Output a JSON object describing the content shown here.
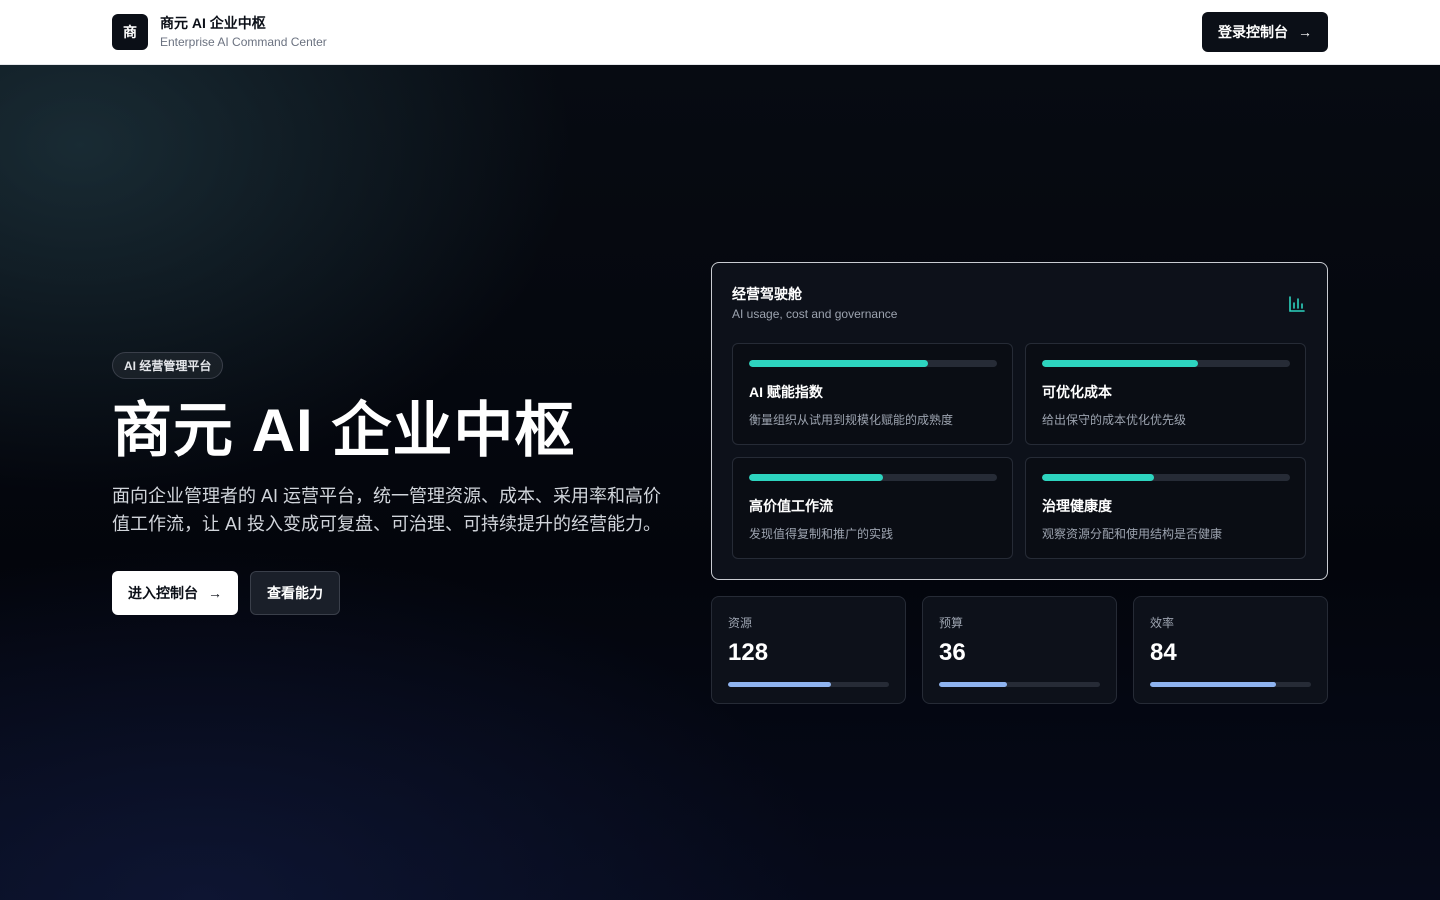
{
  "header": {
    "logo_char": "商",
    "brand_name": "商元 AI 企业中枢",
    "brand_sub": "Enterprise AI Command Center",
    "login_label": "登录控制台",
    "arrow": "→"
  },
  "hero": {
    "badge": "AI 经营管理平台",
    "title": "商元 AI 企业中枢",
    "description": "面向企业管理者的 AI 运营平台，统一管理资源、成本、采用率和高价值工作流，让 AI 投入变成可复盘、可治理、可持续提升的经营能力。",
    "primary_label": "进入控制台",
    "secondary_label": "查看能力",
    "arrow": "→"
  },
  "panel": {
    "title": "经营驾驶舱",
    "subtitle": "AI usage, cost and governance",
    "icon": "bar-chart-icon",
    "accent": "#2dd4bf",
    "features": [
      {
        "title": "AI 赋能指数",
        "desc": "衡量组织从试用到规模化赋能的成熟度",
        "progress": 0.72
      },
      {
        "title": "可优化成本",
        "desc": "给出保守的成本优化优先级",
        "progress": 0.63
      },
      {
        "title": "高价值工作流",
        "desc": "发现值得复制和推广的实践",
        "progress": 0.54
      },
      {
        "title": "治理健康度",
        "desc": "观察资源分配和使用结构是否健康",
        "progress": 0.45
      }
    ]
  },
  "stats": [
    {
      "label": "资源",
      "value": "128",
      "progress": 0.64
    },
    {
      "label": "预算",
      "value": "36",
      "progress": 0.42
    },
    {
      "label": "效率",
      "value": "84",
      "progress": 0.78
    }
  ]
}
